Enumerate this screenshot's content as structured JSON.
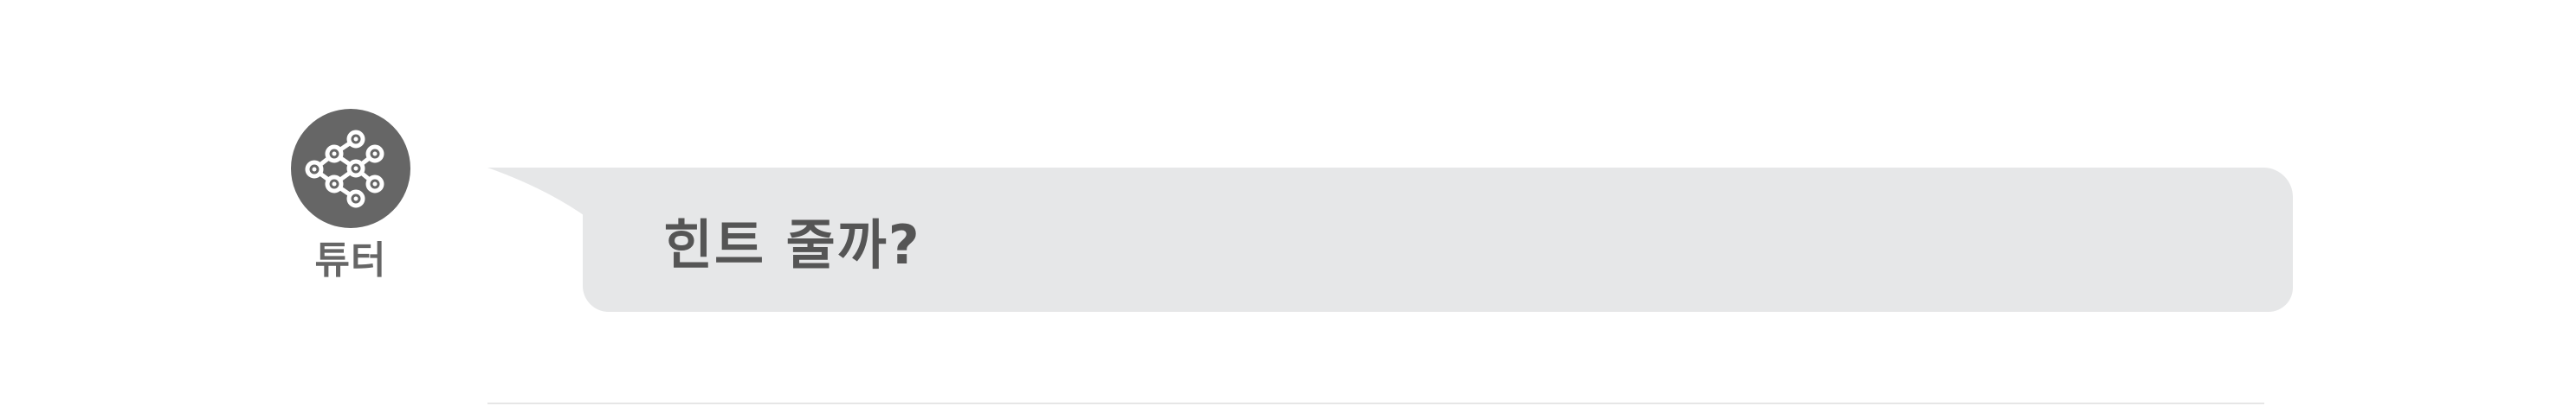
{
  "tutor": {
    "name": "튜터",
    "avatar_icon": "chain-network-icon",
    "avatar_color": "#666666"
  },
  "message": {
    "text": "힌트 줄까?",
    "bubble_color": "#e6e7e8",
    "text_color": "#555555"
  }
}
